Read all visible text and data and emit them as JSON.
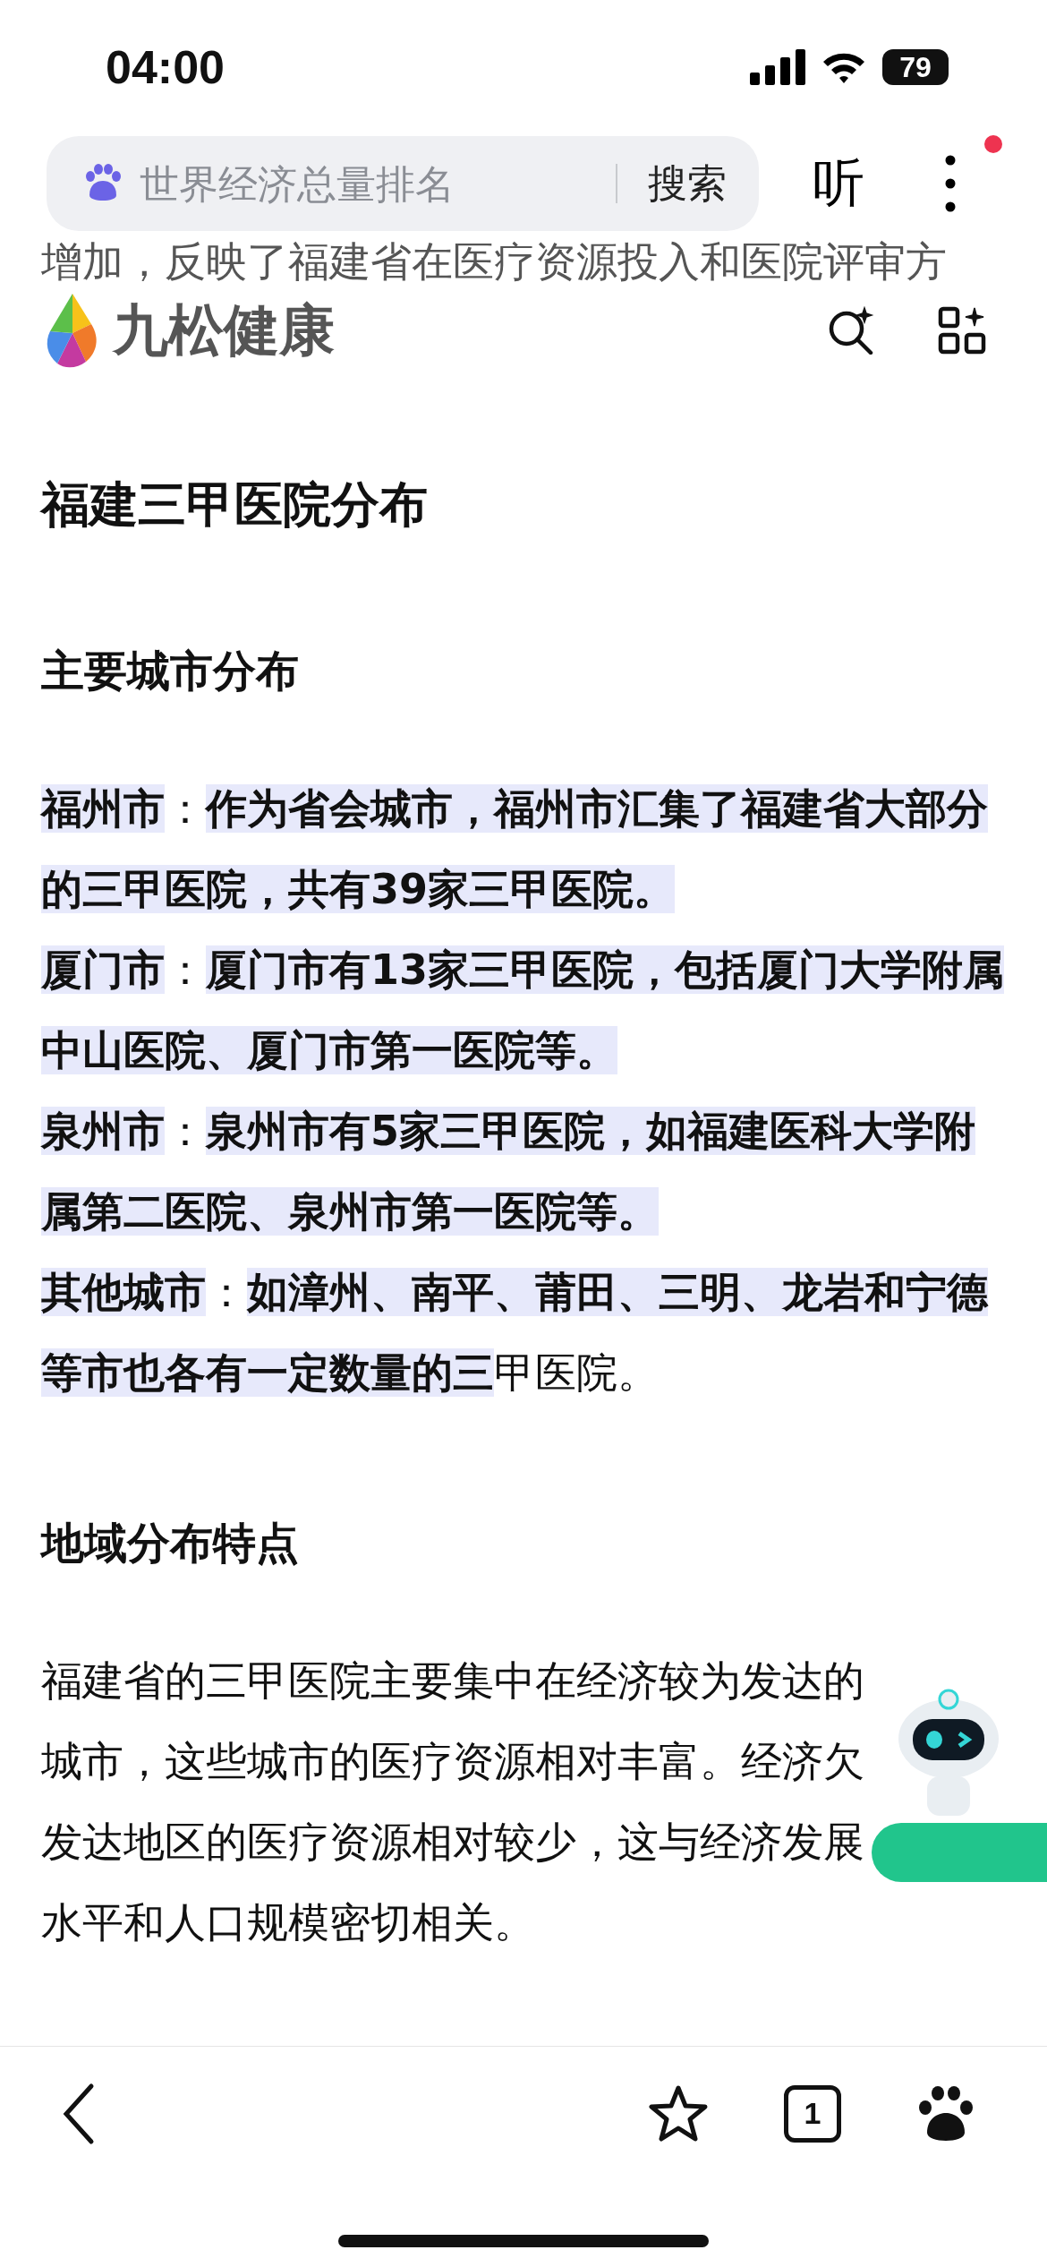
{
  "status_bar": {
    "time": "04:00",
    "battery": "79"
  },
  "search_bar": {
    "placeholder": "世界经济总量排名",
    "button": "搜索"
  },
  "listen_button": "听",
  "menu": {
    "notification": true
  },
  "clipped_text": "增加，反映了福建省在医疗资源投入和医院评审方",
  "site_header": {
    "name": "九松健康"
  },
  "title": "福建三甲医院分布",
  "sections": [
    {
      "heading": "主要城市分布",
      "paragraphs": [
        {
          "segments": [
            {
              "text": "福州市",
              "highlighted": true
            },
            {
              "text": "：",
              "highlighted": false
            },
            {
              "text": "作为省会城市，福州市汇集了福建省大部分的三甲医院，共有39家三甲医院。",
              "highlighted": true
            }
          ]
        },
        {
          "segments": [
            {
              "text": "厦门市",
              "highlighted": true
            },
            {
              "text": "：",
              "highlighted": false
            },
            {
              "text": "厦门市有13家三甲医院，包括厦门大学附属中山医院、厦门市第一医院等。",
              "highlighted": true
            }
          ]
        },
        {
          "segments": [
            {
              "text": "泉州市",
              "highlighted": true
            },
            {
              "text": "：",
              "highlighted": false
            },
            {
              "text": "泉州市有5家三甲医院，如福建医科大学附属第二医院、泉州市第一医院等。",
              "highlighted": true
            }
          ]
        },
        {
          "segments": [
            {
              "text": "其他城市",
              "highlighted": true
            },
            {
              "text": "：",
              "highlighted": false
            },
            {
              "text": "如漳州、南平、莆田、三明、龙岩和宁德等市也各有一定数量的三",
              "highlighted": true
            },
            {
              "text": "甲医院。",
              "highlighted": false
            }
          ]
        }
      ]
    },
    {
      "heading": "地域分布特点",
      "paragraphs": [
        {
          "segments": [
            {
              "text": "福建省的三甲医院主要集中在经济较为发达的城市，这些城市的医疗资源相对丰富。经济欠发达地区的医疗资源相对较少，这与经济发展水平和人口规模密切相关。",
              "highlighted": false
            }
          ]
        }
      ]
    }
  ],
  "bottom_bar": {
    "tab_count": "1"
  }
}
